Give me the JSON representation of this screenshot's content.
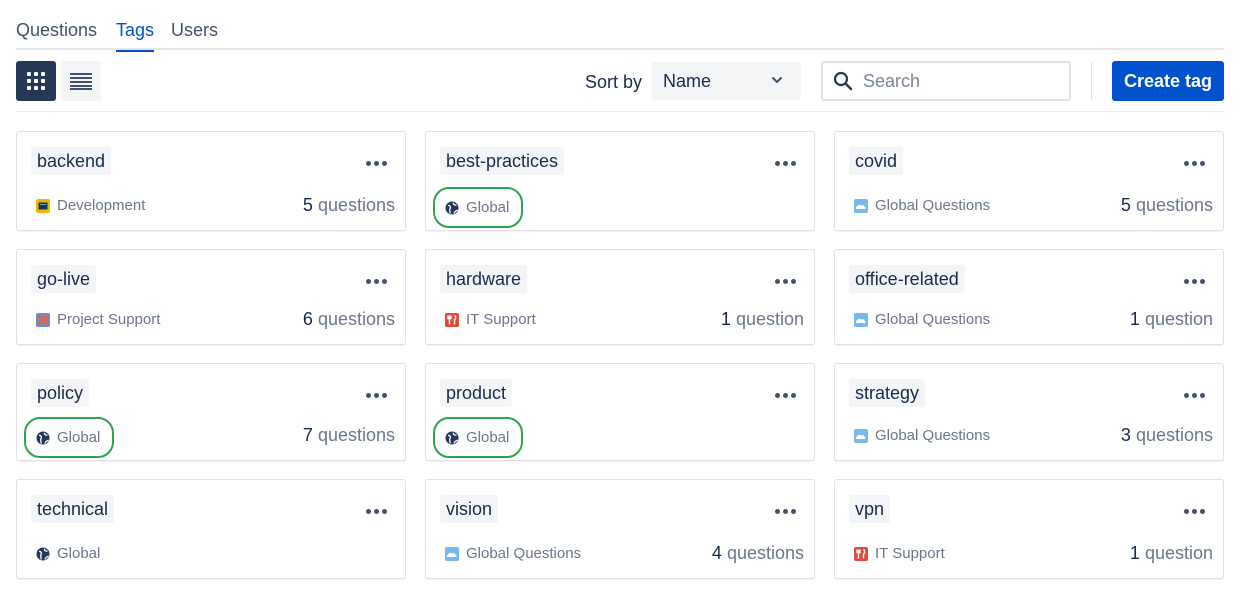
{
  "tabs": [
    {
      "label": "Questions",
      "active": false
    },
    {
      "label": "Tags",
      "active": true
    },
    {
      "label": "Users",
      "active": false
    }
  ],
  "toolbar": {
    "view_grid_icon": "grid-view-icon",
    "view_list_icon": "list-view-icon",
    "sort_label": "Sort by",
    "sort_value": "Name",
    "search_placeholder": "Search",
    "search_value": "",
    "create_label": "Create tag"
  },
  "colors": {
    "accent": "#0052cc",
    "highlight_ring": "#2da44e",
    "dark_button": "#253858"
  },
  "cards": [
    {
      "tag": "backend",
      "space": "Development",
      "space_icon": "development-space-icon",
      "count": "5",
      "unit": "questions"
    },
    {
      "tag": "best-practices",
      "space": "Global",
      "space_icon": "globe-icon",
      "count": "",
      "unit": "",
      "highlighted": true
    },
    {
      "tag": "covid",
      "space": "Global Questions",
      "space_icon": "cloud-space-icon",
      "count": "5",
      "unit": "questions"
    },
    {
      "tag": "go-live",
      "space": "Project Support",
      "space_icon": "project-support-icon",
      "count": "6",
      "unit": "questions"
    },
    {
      "tag": "hardware",
      "space": "IT Support",
      "space_icon": "it-support-icon",
      "count": "1",
      "unit": "question"
    },
    {
      "tag": "office-related",
      "space": "Global Questions",
      "space_icon": "cloud-space-icon",
      "count": "1",
      "unit": "question"
    },
    {
      "tag": "policy",
      "space": "Global",
      "space_icon": "globe-icon",
      "count": "7",
      "unit": "questions",
      "highlighted": true
    },
    {
      "tag": "product",
      "space": "Global",
      "space_icon": "globe-icon",
      "count": "",
      "unit": "",
      "highlighted": true
    },
    {
      "tag": "strategy",
      "space": "Global Questions",
      "space_icon": "cloud-space-icon",
      "count": "3",
      "unit": "questions"
    },
    {
      "tag": "technical",
      "space": "Global",
      "space_icon": "globe-icon",
      "count": "",
      "unit": ""
    },
    {
      "tag": "vision",
      "space": "Global Questions",
      "space_icon": "cloud-space-icon",
      "count": "4",
      "unit": "questions"
    },
    {
      "tag": "vpn",
      "space": "IT Support",
      "space_icon": "it-support-icon",
      "count": "1",
      "unit": "question"
    }
  ]
}
